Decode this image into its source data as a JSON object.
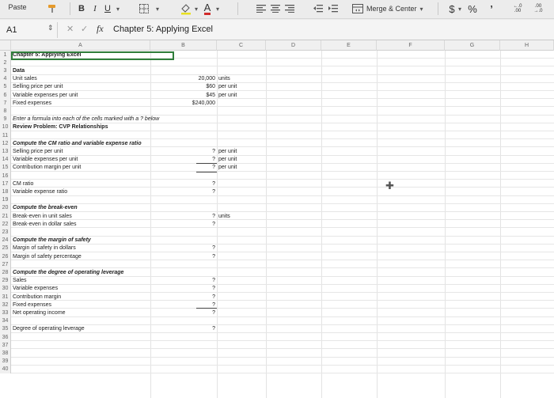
{
  "ribbon": {
    "paste": "Paste",
    "bold": "B",
    "italic": "I",
    "underline": "U",
    "font_color": "A",
    "merge_center": "Merge & Center",
    "currency": "$",
    "percent": "%",
    "comma": "’",
    "dec_increase": "←.0 .00",
    "dec_decrease": ".00 →.0"
  },
  "formula_bar": {
    "name_box": "A1",
    "fx": "fx",
    "formula": "Chapter 5: Applying Excel"
  },
  "columns": [
    "A",
    "B",
    "C",
    "D",
    "E",
    "F",
    "G",
    "H"
  ],
  "rows": [
    {
      "n": "1",
      "a": "Chapter 5: Applying Excel",
      "b": "",
      "c": ""
    },
    {
      "n": "2",
      "a": "",
      "b": "",
      "c": ""
    },
    {
      "n": "3",
      "a": "Data",
      "b": "",
      "c": ""
    },
    {
      "n": "4",
      "a": "Unit sales",
      "b": "20,000",
      "c": "units"
    },
    {
      "n": "5",
      "a": "Selling price per unit",
      "b": "$60",
      "c": "per unit"
    },
    {
      "n": "6",
      "a": "Variable expenses per unit",
      "b": "$45",
      "c": "per unit"
    },
    {
      "n": "7",
      "a": "Fixed expenses",
      "b": "$240,000",
      "c": ""
    },
    {
      "n": "8",
      "a": "",
      "b": "",
      "c": ""
    },
    {
      "n": "9",
      "a": "Enter a formula into each of the cells marked with a ? below",
      "b": "",
      "c": ""
    },
    {
      "n": "10",
      "a": "Review Problem: CVP Relationships",
      "b": "",
      "c": ""
    },
    {
      "n": "11",
      "a": "",
      "b": "",
      "c": ""
    },
    {
      "n": "12",
      "a": "Compute the CM ratio and variable expense ratio",
      "b": "",
      "c": ""
    },
    {
      "n": "13",
      "a": "Selling price per unit",
      "b": "?",
      "c": "per unit"
    },
    {
      "n": "14",
      "a": "Variable expenses per unit",
      "b": "?",
      "c": "per unit"
    },
    {
      "n": "15",
      "a": "Contribution margin per unit",
      "b": "?",
      "c": "per unit"
    },
    {
      "n": "16",
      "a": "",
      "b": "",
      "c": ""
    },
    {
      "n": "17",
      "a": "CM ratio",
      "b": "?",
      "c": ""
    },
    {
      "n": "18",
      "a": "Variable expense ratio",
      "b": "?",
      "c": ""
    },
    {
      "n": "19",
      "a": "",
      "b": "",
      "c": ""
    },
    {
      "n": "20",
      "a": "Compute the break-even",
      "b": "",
      "c": ""
    },
    {
      "n": "21",
      "a": "Break-even in unit sales",
      "b": "?",
      "c": "units"
    },
    {
      "n": "22",
      "a": "Break-even in dollar sales",
      "b": "?",
      "c": ""
    },
    {
      "n": "23",
      "a": "",
      "b": "",
      "c": ""
    },
    {
      "n": "24",
      "a": "Compute the margin of safety",
      "b": "",
      "c": ""
    },
    {
      "n": "25",
      "a": "Margin of safety in dollars",
      "b": "?",
      "c": ""
    },
    {
      "n": "26",
      "a": "Margin of safety percentage",
      "b": "?",
      "c": ""
    },
    {
      "n": "27",
      "a": "",
      "b": "",
      "c": ""
    },
    {
      "n": "28",
      "a": "Compute the degree of operating leverage",
      "b": "",
      "c": ""
    },
    {
      "n": "29",
      "a": "Sales",
      "b": "?",
      "c": ""
    },
    {
      "n": "30",
      "a": "Variable expenses",
      "b": "?",
      "c": ""
    },
    {
      "n": "31",
      "a": "Contribution margin",
      "b": "?",
      "c": ""
    },
    {
      "n": "32",
      "a": "Fixed expenses",
      "b": "?",
      "c": ""
    },
    {
      "n": "33",
      "a": "Net operating income",
      "b": "?",
      "c": ""
    },
    {
      "n": "34",
      "a": "",
      "b": "",
      "c": ""
    },
    {
      "n": "35",
      "a": "Degree of operating leverage",
      "b": "?",
      "c": ""
    },
    {
      "n": "36",
      "a": "",
      "b": "",
      "c": ""
    },
    {
      "n": "37",
      "a": "",
      "b": "",
      "c": ""
    },
    {
      "n": "38",
      "a": "",
      "b": "",
      "c": ""
    },
    {
      "n": "39",
      "a": "",
      "b": "",
      "c": ""
    },
    {
      "n": "40",
      "a": "",
      "b": "",
      "c": ""
    }
  ],
  "styles": {
    "bold_rows": [
      "1",
      "3",
      "10",
      "12",
      "20",
      "24",
      "28"
    ],
    "italic_rows": [
      "9",
      "12",
      "20",
      "24",
      "28"
    ],
    "selection_color": "#2f7d3a"
  }
}
